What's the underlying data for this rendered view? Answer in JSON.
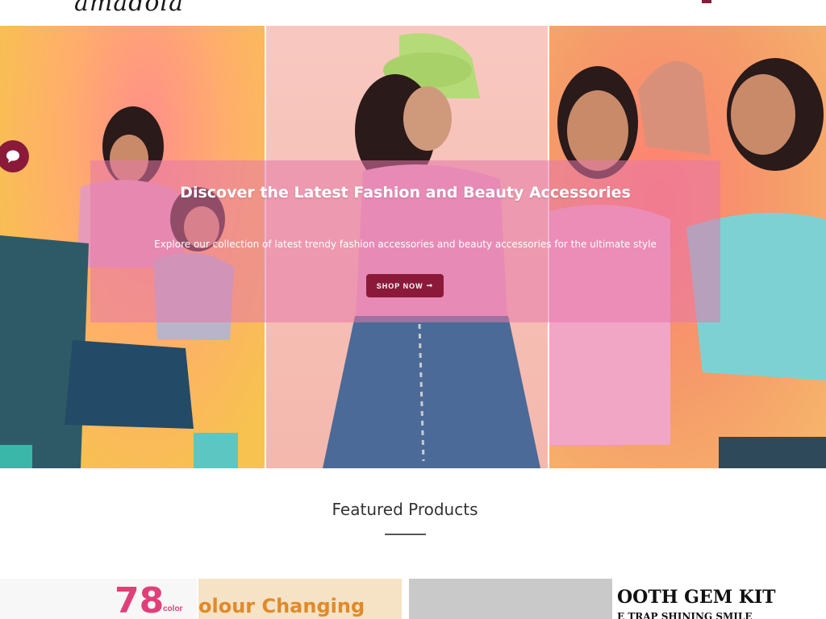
{
  "header": {
    "logo": "amadola"
  },
  "hero": {
    "title": "Discover the Latest Fashion and Beauty Accessories",
    "subtitle": "Explore our collection of latest trendy fashion accessories and beauty accessories for the ultimate style",
    "shop_button_label": "SHOP NOW",
    "shop_button_icon": "arrow-right-icon",
    "colors": {
      "overlay": "#e678aa",
      "button": "#8b1a3a"
    }
  },
  "chat": {
    "icon": "chat-bubble-icon"
  },
  "featured": {
    "title": "Featured Products",
    "cards": [
      {
        "line1": "78",
        "line2": "color"
      },
      {
        "line1": "olour Changing"
      },
      {
        "line1": ""
      },
      {
        "line1": "OOTH GEM KIT",
        "line2": "E TRAP SHINING SMILE"
      }
    ]
  }
}
